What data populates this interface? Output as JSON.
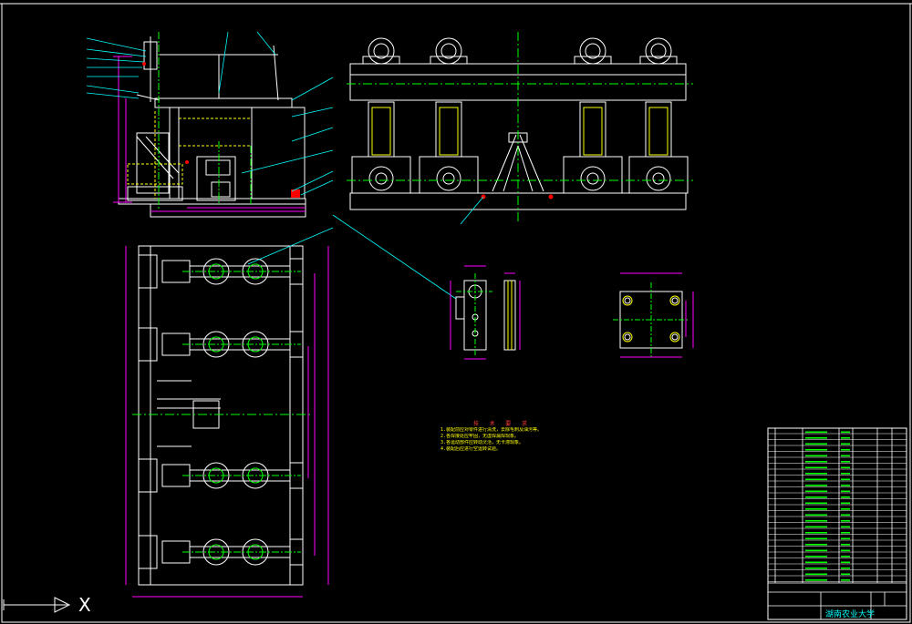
{
  "ucs_axis_label": "X",
  "technical_requirements": {
    "title": "技 术 要 求",
    "lines": [
      "1.装配前应对零件进行清洗，去除毛刺及油污等。",
      "2.各焊接处应牢固，无虚焊漏焊现象。",
      "3.各运动部件应转动灵活，无卡滞现象。",
      "4.装配后应进行空运转试验。"
    ]
  },
  "title_block": {
    "school": "湖南农业大学"
  },
  "colors": {
    "background": "#000000",
    "frame": "#ffffff",
    "geometry": "#ffffff",
    "center_lines": "#00ff00",
    "dimension": "#ff00ff",
    "leaders": "#00ffff",
    "hidden": "#ffff00",
    "accent": "#ff0000"
  }
}
